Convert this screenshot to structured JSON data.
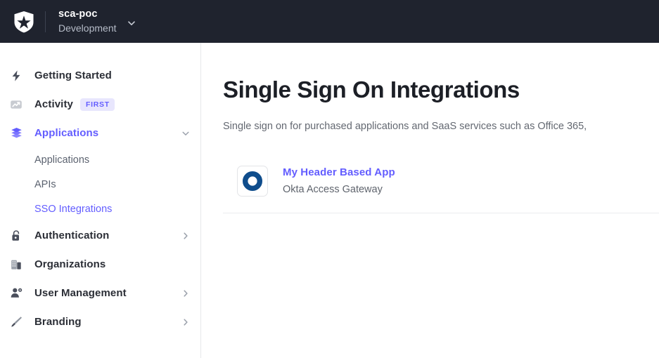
{
  "topbar": {
    "logo_icon": "auth0-shield-logo",
    "tenant_name": "sca-poc",
    "environment": "Development",
    "dropdown_icon": "chevron-down-icon"
  },
  "sidebar": {
    "items": [
      {
        "label": "Getting Started",
        "icon": "lightning-bolt-icon",
        "active": false,
        "caret": "",
        "badge": ""
      },
      {
        "label": "Activity",
        "icon": "activity-chart-icon",
        "active": false,
        "caret": "",
        "badge": "FIRST"
      },
      {
        "label": "Applications",
        "icon": "layers-stack-icon",
        "active": true,
        "caret": "chevron-down-icon",
        "badge": ""
      },
      {
        "label": "Authentication",
        "icon": "lock-icon",
        "active": false,
        "caret": "chevron-right-icon",
        "badge": ""
      },
      {
        "label": "Organizations",
        "icon": "building-icon",
        "active": false,
        "caret": "",
        "badge": ""
      },
      {
        "label": "User Management",
        "icon": "user-gear-icon",
        "active": false,
        "caret": "chevron-right-icon",
        "badge": ""
      },
      {
        "label": "Branding",
        "icon": "paintbrush-icon",
        "active": false,
        "caret": "chevron-right-icon",
        "badge": ""
      }
    ],
    "subitems": [
      {
        "label": "Applications",
        "active": false
      },
      {
        "label": "APIs",
        "active": false
      },
      {
        "label": "SSO Integrations",
        "active": true
      }
    ]
  },
  "main": {
    "title": "Single Sign On Integrations",
    "subtitle": "Single sign on for purchased applications and SaaS services such as Office 365,",
    "integrations": [
      {
        "name": "My Header Based App",
        "provider": "Okta Access Gateway",
        "icon": "okta-ring-icon"
      }
    ]
  },
  "colors": {
    "accent_purple": "#635dff",
    "topbar_background": "#1f232e",
    "badge_background": "#e8e6fd",
    "okta_blue": "#0f4d8c"
  }
}
